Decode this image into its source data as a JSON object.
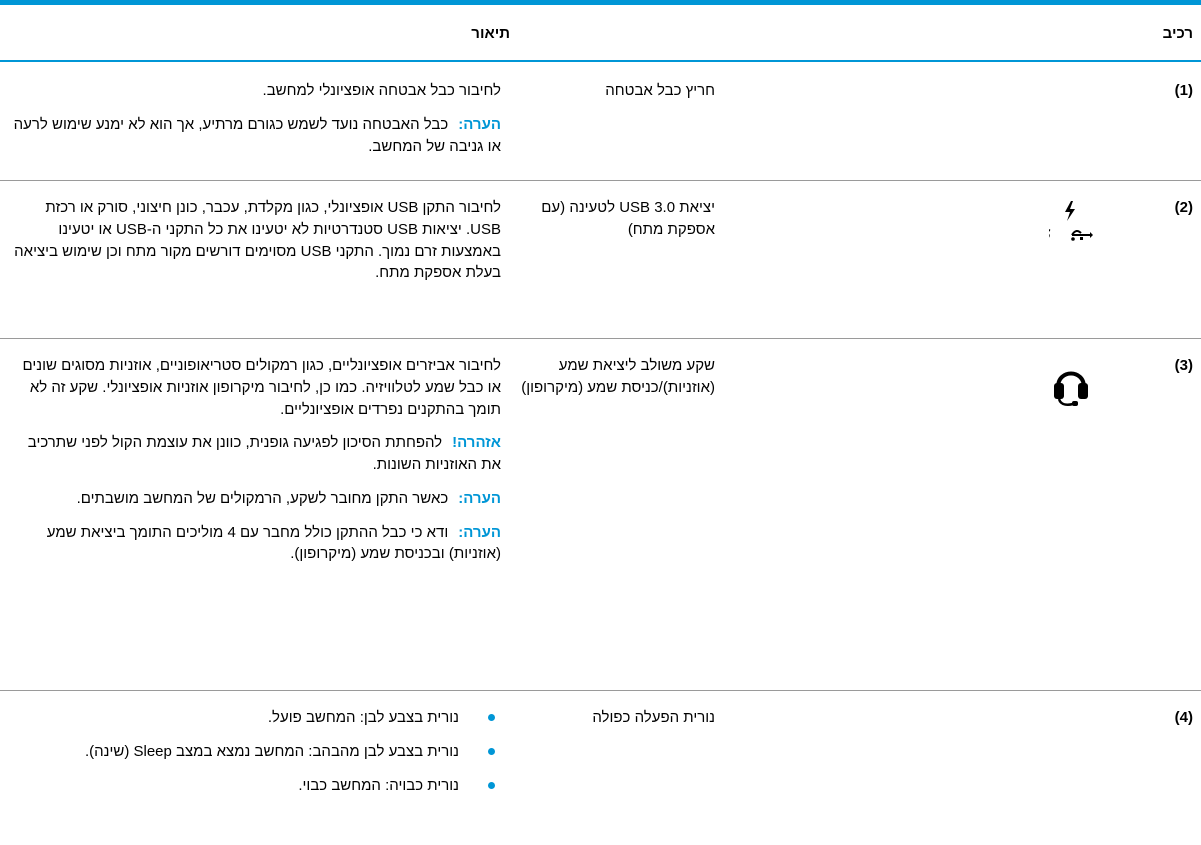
{
  "table": {
    "headers": {
      "component": "רכיב",
      "description": "תיאור"
    },
    "rows": [
      {
        "number": "(1)",
        "name": "חריץ כבל אבטחה",
        "desc": "לחיבור כבל אבטחה אופציונלי למחשב.",
        "note_label": "הערה:",
        "note_text": "כבל האבטחה נועד לשמש כגורם מרתיע, אך הוא לא ימנע שימוש לרעה או גניבה של המחשב."
      },
      {
        "number": "(2)",
        "icon": "usb-superspeed-charging-icon",
        "name": "יציאת USB 3.0 לטעינה (עם אספקת מתח)",
        "desc": "לחיבור התקן USB אופציונלי, כגון מקלדת, עכבר, כונן חיצוני, סורק או רכזת USB. יציאות USB סטנדרטיות לא יטעינו את כל התקני ה-USB או יטעינו באמצעות זרם נמוך. התקני USB מסוימים דורשים מקור מתח וכן שימוש ביציאה בעלת אספקת מתח."
      },
      {
        "number": "(3)",
        "icon": "headset-icon",
        "name": "שקע משולב ליציאת שמע (אוזניות)/כניסת שמע (מיקרופון)",
        "desc": "לחיבור אביזרים אופציונליים, כגון רמקולים סטריאופוניים, אוזניות מסוגים שונים או כבל שמע לטלוויזיה. כמו כן, לחיבור מיקרופון אוזניות אופציונלי. שקע זה לא תומך בהתקנים נפרדים אופציונליים.",
        "warning_label": "אזהרה!",
        "warning_text": "להפחתת הסיכון לפגיעה גופנית, כוונן את עוצמת הקול לפני שתרכיב את האוזניות השונות.",
        "note1_label": "הערה:",
        "note1_text": "כאשר התקן מחובר לשקע, הרמקולים של המחשב מושבתים.",
        "note2_label": "הערה:",
        "note2_text": "ודא כי כבל ההתקן כולל מחבר עם 4 מוליכים התומך ביציאת שמע (אוזניות) ובכניסת שמע (מיקרופון)."
      },
      {
        "number": "(4)",
        "name": "נורית הפעלה כפולה",
        "bullets": [
          "נורית בצבע לבן: המחשב פועל.",
          "נורית בצבע לבן מהבהב: המחשב נמצא במצב Sleep (שינה).",
          "נורית כבויה: המחשב כבוי."
        ]
      }
    ]
  },
  "colors": {
    "accent": "#0096d6",
    "row_divider": "#9a9a9a"
  }
}
